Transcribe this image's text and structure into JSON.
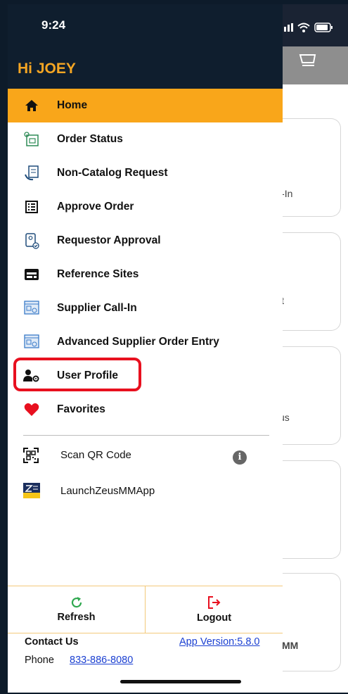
{
  "status_bar": {
    "time": "9:24"
  },
  "background": {
    "card_fragments": [
      "l-In",
      "it",
      "us",
      "",
      "MM"
    ]
  },
  "drawer": {
    "greeting": "Hi JOEY",
    "menu_items": [
      {
        "label": "Home",
        "icon": "home-icon",
        "active": true
      },
      {
        "label": "Order Status",
        "icon": "order-status-icon"
      },
      {
        "label": "Non-Catalog Request",
        "icon": "non-catalog-icon"
      },
      {
        "label": "Approve Order",
        "icon": "approve-order-icon"
      },
      {
        "label": "Requestor Approval",
        "icon": "requestor-approval-icon"
      },
      {
        "label": "Reference Sites",
        "icon": "reference-sites-icon"
      },
      {
        "label": "Supplier Call-In",
        "icon": "supplier-call-in-icon"
      },
      {
        "label": "Advanced Supplier Order Entry",
        "icon": "supplier-order-entry-icon"
      },
      {
        "label": "User Profile",
        "icon": "user-settings-icon"
      },
      {
        "label": "Favorites",
        "icon": "heart-icon"
      }
    ],
    "extra_items": [
      {
        "label": "Scan QR Code",
        "icon": "qr-code-icon"
      },
      {
        "label": "LaunchZeusMMApp",
        "icon": "zeus-logo-icon"
      }
    ],
    "actions": {
      "refresh": "Refresh",
      "logout": "Logout"
    },
    "footer": {
      "contact": "Contact Us",
      "version": "App Version:5.8.0",
      "phone_label": "Phone",
      "phone": "833-886-8080"
    }
  },
  "colors": {
    "accent": "#f9a61a",
    "greeting": "#f5a623",
    "highlight": "#e8101f",
    "link": "#1a3fd1"
  }
}
